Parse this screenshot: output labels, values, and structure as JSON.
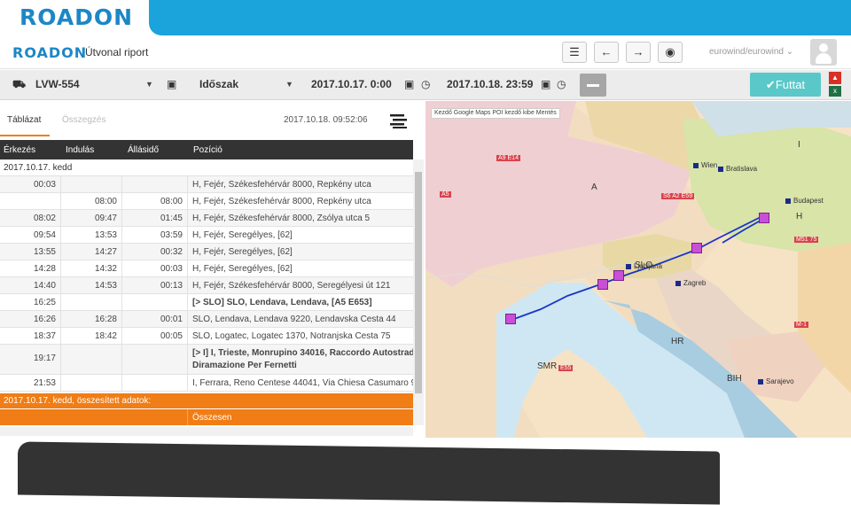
{
  "brand": "ROADON",
  "header": {
    "report_title": "Útvonal riport",
    "user": "eurowind/eurowind"
  },
  "filters": {
    "vehicle": "LVW-554",
    "period_label": "Időszak",
    "from": "2017.10.17. 0:00",
    "to": "2017.10.18. 23:59",
    "run_label": "Futtat"
  },
  "tabs": {
    "table": "Táblázat",
    "summary": "Összegzés",
    "timestamp": "2017.10.18. 09:52:06"
  },
  "table": {
    "headers": [
      "Érkezés",
      "Indulás",
      "Állásidő",
      "Pozíció"
    ],
    "day_header": "2017.10.17. kedd",
    "rows": [
      {
        "arr": "00:03",
        "dep": "",
        "stay": "",
        "pos": "H, Fejér, Székesfehérvár 8000, Repkény utca"
      },
      {
        "arr": "",
        "dep": "08:00",
        "stay": "08:00",
        "pos": "H, Fejér, Székesfehérvár 8000, Repkény utca"
      },
      {
        "arr": "08:02",
        "dep": "09:47",
        "stay": "01:45",
        "pos": "H, Fejér, Székesfehérvár 8000, Zsólya utca 5"
      },
      {
        "arr": "09:54",
        "dep": "13:53",
        "stay": "03:59",
        "pos": "H, Fejér, Seregélyes, [62]"
      },
      {
        "arr": "13:55",
        "dep": "14:27",
        "stay": "00:32",
        "pos": "H, Fejér, Seregélyes, [62]"
      },
      {
        "arr": "14:28",
        "dep": "14:32",
        "stay": "00:03",
        "pos": "H, Fejér, Seregélyes, [62]"
      },
      {
        "arr": "14:40",
        "dep": "14:53",
        "stay": "00:13",
        "pos": "H, Fejér, Székesfehérvár 8000, Seregélyesi út 121"
      },
      {
        "arr": "16:25",
        "dep": "",
        "stay": "",
        "pos": "[> SLO] SLO, Lendava, Lendava, [A5 E653]"
      },
      {
        "arr": "16:26",
        "dep": "16:28",
        "stay": "00:01",
        "pos": "SLO, Lendava, Lendava 9220, Lendavska Cesta 44"
      },
      {
        "arr": "18:37",
        "dep": "18:42",
        "stay": "00:05",
        "pos": "SLO, Logatec, Logatec 1370, Notranjska Cesta 75"
      },
      {
        "arr": "19:17",
        "dep": "",
        "stay": "",
        "pos": "[> I] I, Trieste, Monrupino 34016, Raccordo Autostrada",
        "pos2": "Diramazione Per Fernetti"
      },
      {
        "arr": "21:53",
        "dep": "",
        "stay": "",
        "pos": "I, Ferrara, Reno Centese 44041, Via Chiesa Casumaro 9"
      }
    ],
    "summary_row": "2017.10.17. kedd, összesített adatok:",
    "total_label": "Összesen"
  },
  "map": {
    "toolbar": "Kezdő   Google Maps   POI kezdő kibe   Mentés",
    "countries": [
      "A",
      "H",
      "SLO",
      "HR",
      "BIH",
      "SMR",
      "I"
    ],
    "cities": [
      "Wien",
      "Bratislava",
      "Budapest",
      "Zagreb",
      "Ljubljana",
      "Sarajevo"
    ],
    "roads": [
      "A9 E14",
      "A5",
      "S6 A2 E59",
      "M51 75",
      "M-1",
      "E55"
    ]
  }
}
